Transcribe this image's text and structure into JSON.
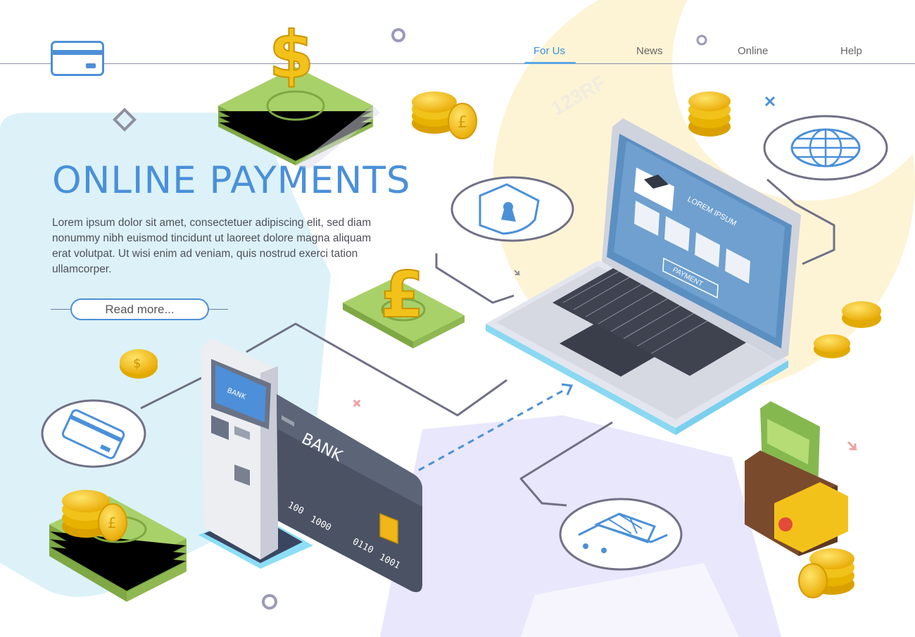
{
  "nav": {
    "items": [
      {
        "label": "For Us",
        "active": true
      },
      {
        "label": "News",
        "active": false
      },
      {
        "label": "Online",
        "active": false
      },
      {
        "label": "Help",
        "active": false
      }
    ]
  },
  "hero": {
    "title": "ONLINE PAYMENTS",
    "body": "Lorem ipsum dolor sit amet, consectetuer adipiscing elit, sed diam nonummy nibh euismod tincidunt ut laoreet dolore magna aliquam erat volutpat. Ut wisi enim ad veniam, quis nostrud exerci tation ullamcorper.",
    "read_more": "Read more..."
  },
  "atm": {
    "screen_label": "BANK"
  },
  "card": {
    "label": "BANK",
    "numbers": [
      "100",
      "1000",
      "0110",
      "1001"
    ]
  },
  "laptop": {
    "screen_title": "LOREM IPSUM",
    "screen_button": "PAYMENT"
  },
  "watermark": "123RF",
  "icons": [
    "credit-card-icon",
    "shield-keyhole-icon",
    "globe-icon",
    "shopping-cart-icon",
    "dollar-icon",
    "pound-icon",
    "graduation-cap-icon"
  ],
  "colors": {
    "accent": "#4a90d9",
    "money": "#9bc85a",
    "coin": "#f5c518",
    "wallet": "#7a4a2c",
    "card": "#4a5060"
  }
}
